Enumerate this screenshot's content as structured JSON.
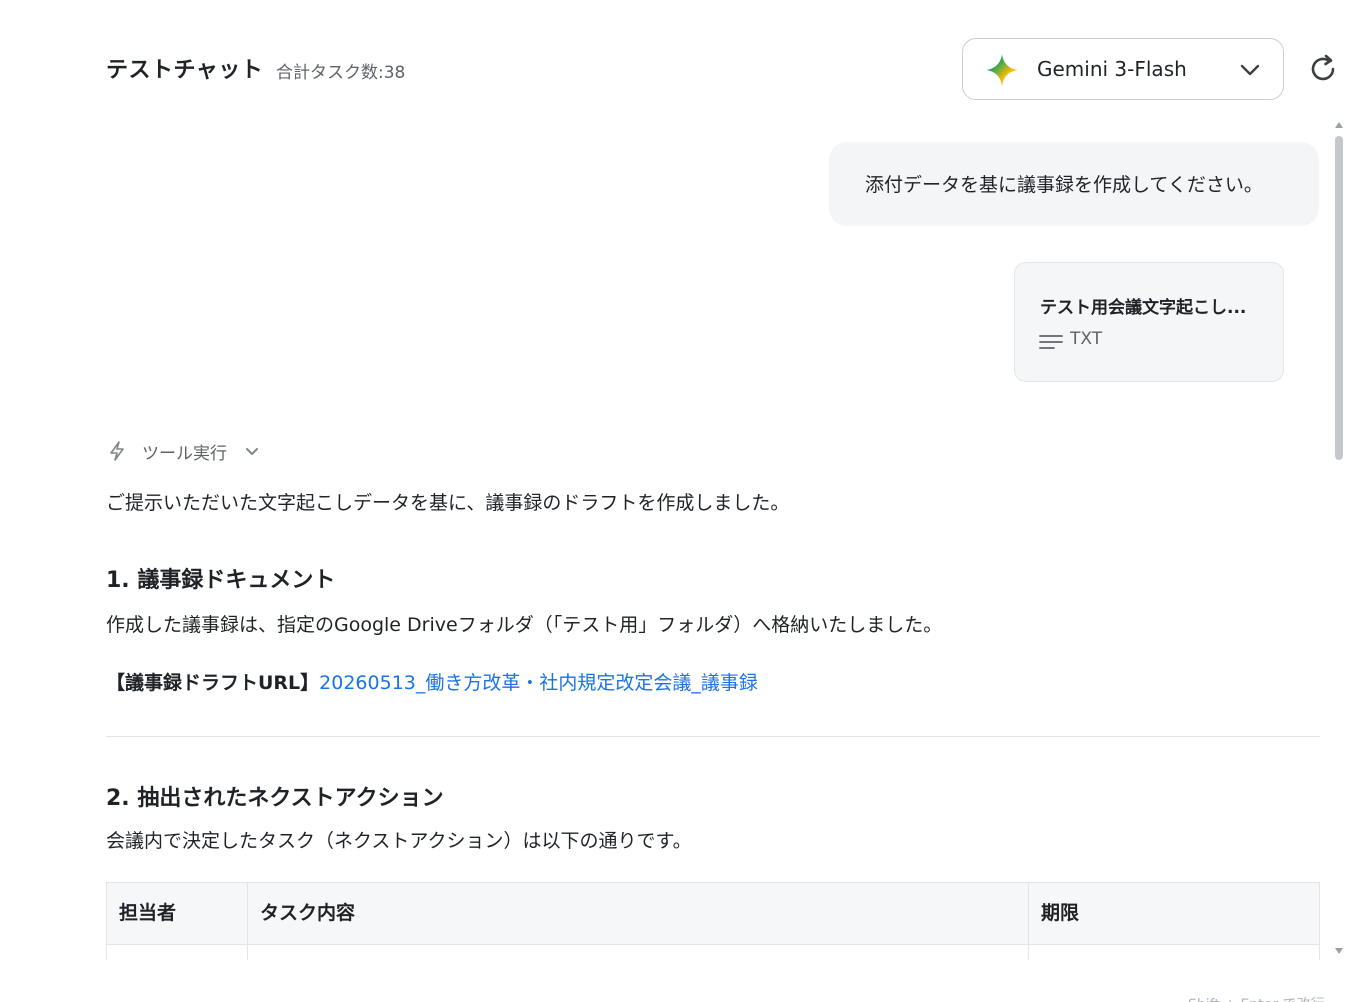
{
  "header": {
    "title": "テストチャット",
    "task_count": "合計タスク数:38",
    "model_label": "Gemini 3-Flash"
  },
  "messages": {
    "user_text": "添付データを基に議事録を作成してください。",
    "attachment": {
      "name": "テスト用会議文字起こし...",
      "type": "TXT"
    }
  },
  "assistant": {
    "tool_label": "ツール実行",
    "intro": "ご提示いただいた文字起こしデータを基に、議事録のドラフトを作成しました。",
    "section1_title": "1. 議事録ドキュメント",
    "section1_text": "作成した議事録は、指定のGoogle Driveフォルダ（「テスト用」フォルダ）へ格納いたしました。",
    "url_label": "【議事録ドラフトURL】",
    "url_text": "20260513_働き方改革・社内規定改定会議_議事録",
    "section2_title": "2. 抽出されたネクストアクション",
    "section2_text": "会議内で決定したタスク（ネクストアクション）は以下の通りです。",
    "table_headers": [
      "担当者",
      "タスク内容",
      "期限"
    ]
  },
  "footer": {
    "hint": "Shift + Enter で改行"
  }
}
